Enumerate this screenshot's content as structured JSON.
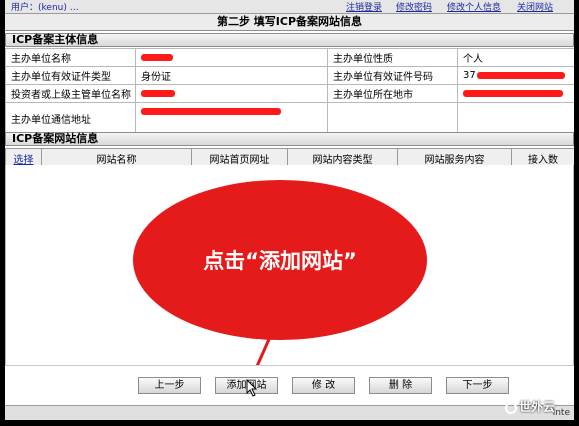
{
  "topnav": {
    "user": "用户：(kenu)  …",
    "links": [
      "注销登录",
      "修改密码",
      "修改个人信息",
      "关闭网站"
    ]
  },
  "step_title": "第二步  填写ICP备案网站信息",
  "subject_section": {
    "title": "ICP备案主体信息",
    "rows": [
      {
        "l1": "主办单位名称",
        "v1": "",
        "l2": "主办单位性质",
        "v2": "个人"
      },
      {
        "l1": "主办单位有效证件类型",
        "v1": "身份证",
        "l2": "主办单位有效证件号码",
        "v2": "37"
      },
      {
        "l1": "投资者或上级主管单位名称",
        "v1": "",
        "l2": "主办单位所在地市",
        "v2": ""
      },
      {
        "l1": "主办单位通信地址",
        "v1": "",
        "l2": "",
        "v2": ""
      }
    ]
  },
  "website_section": {
    "title": "ICP备案网站信息",
    "columns": [
      "选择",
      "网站名称",
      "网站首页网址",
      "网站内容类型",
      "网站服务内容",
      "接入数"
    ]
  },
  "annotation": {
    "text": "点击“添加网站”",
    "color": "#e51a1a"
  },
  "buttons": {
    "prev": "上一步",
    "add": "添加网站",
    "edit": "修  改",
    "delete": "删  除",
    "next": "下一步"
  },
  "statusbar": {
    "label": "Inte"
  },
  "watermark": "世外云"
}
